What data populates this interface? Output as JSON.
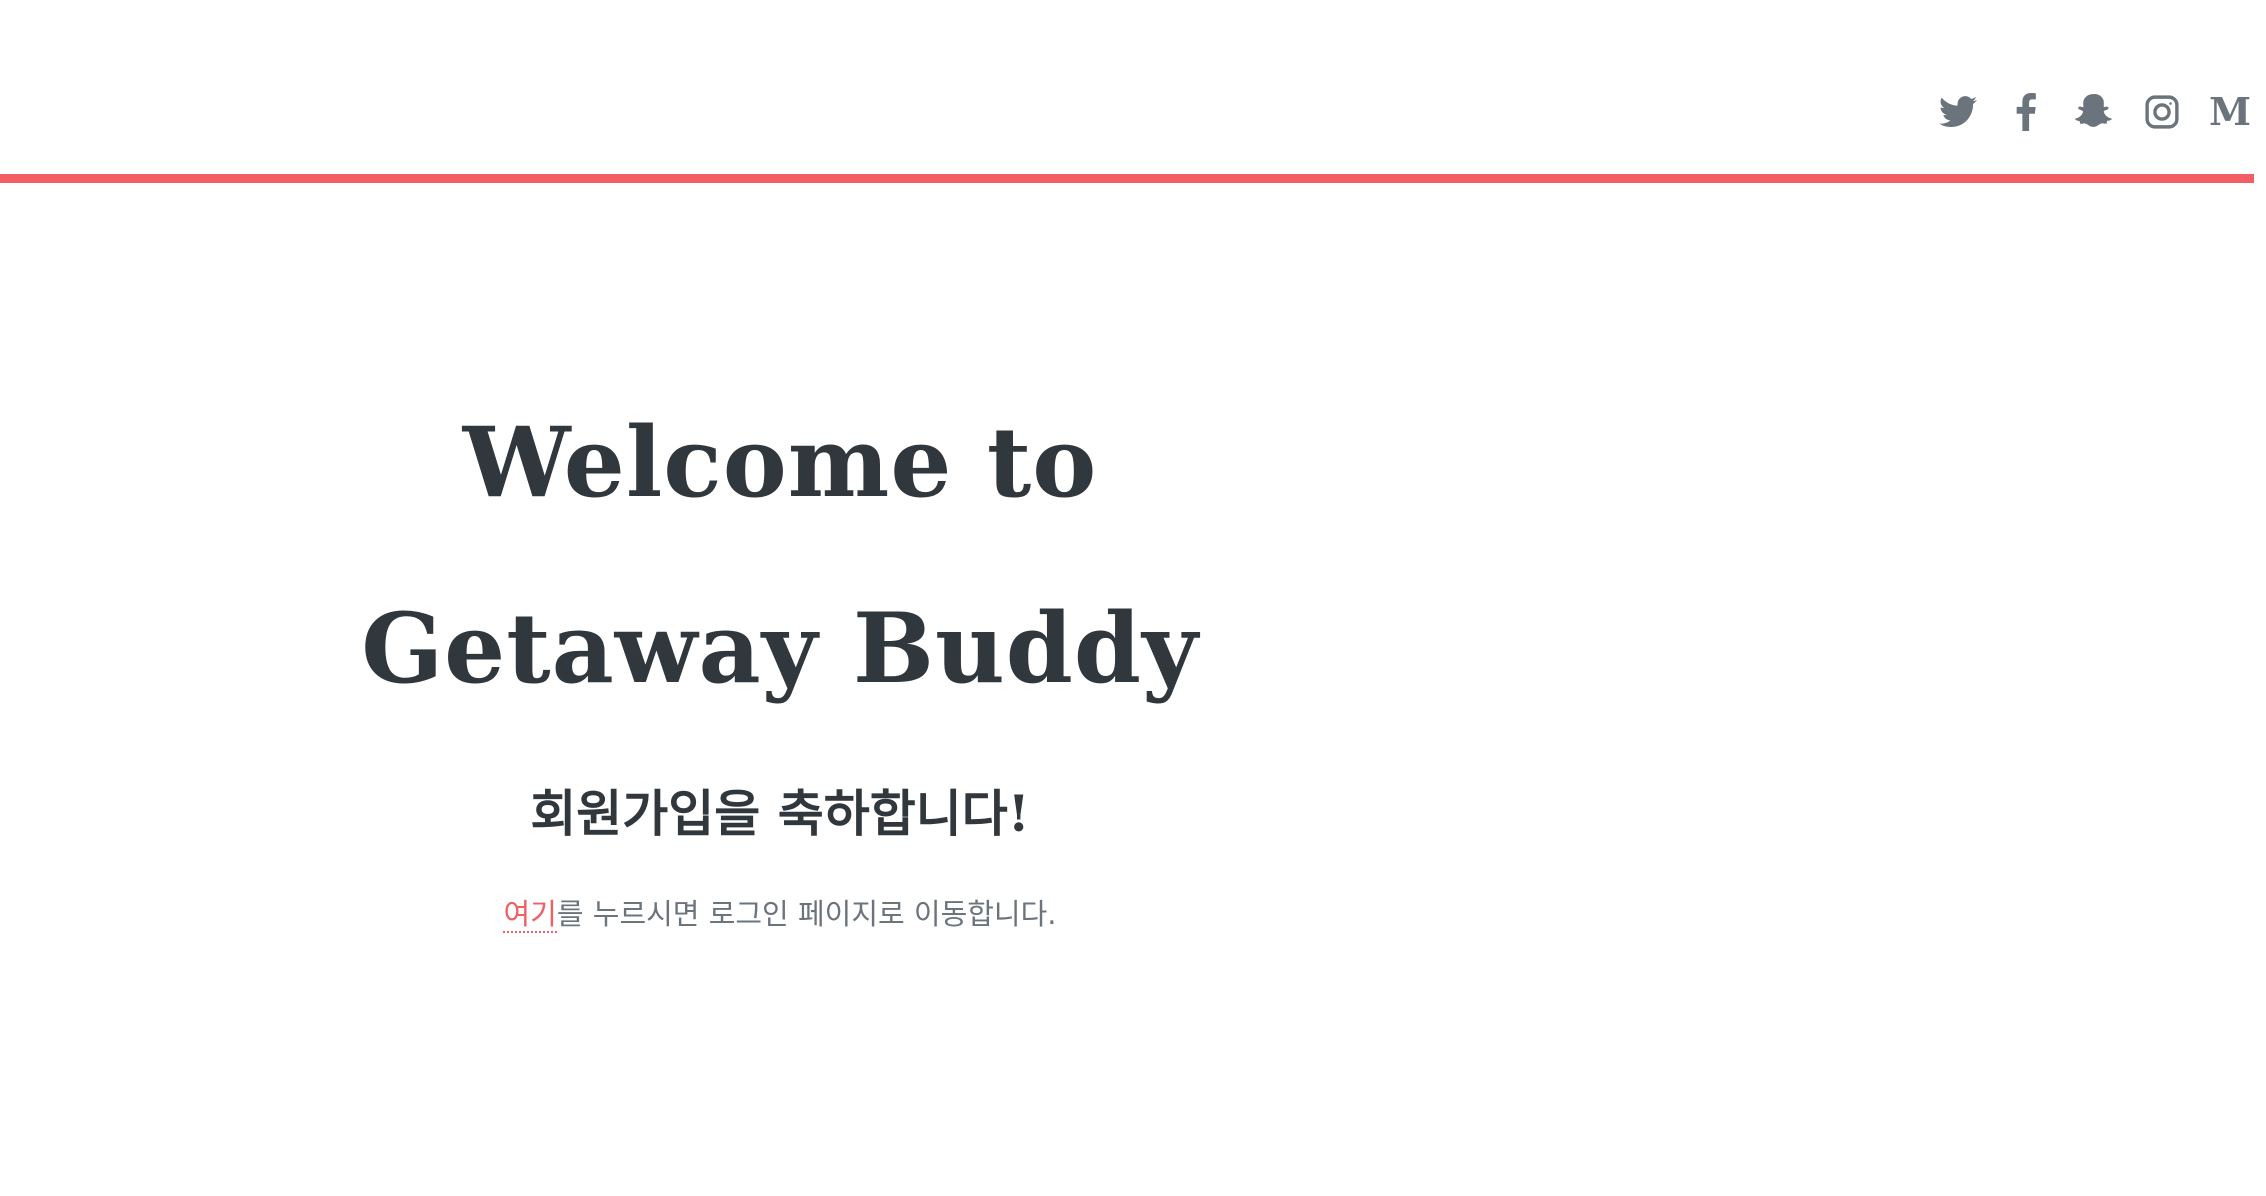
{
  "header": {
    "accent_color": "#f25e64",
    "social_links": [
      {
        "name": "twitter",
        "icon": "twitter-icon"
      },
      {
        "name": "facebook",
        "icon": "facebook-icon"
      },
      {
        "name": "snapchat",
        "icon": "snapchat-icon"
      },
      {
        "name": "instagram",
        "icon": "instagram-icon"
      },
      {
        "name": "medium",
        "icon": "medium-icon",
        "glyph": "M"
      }
    ]
  },
  "main": {
    "title_line1": "Welcome to",
    "title_line2": "Getaway Buddy",
    "subtitle": "회원가입을 축하합니다!",
    "hint_link": "여기",
    "hint_rest": "를 누르시면 로그인 페이지로 이동합니다."
  },
  "colors": {
    "text_dark": "#30373d",
    "text_muted": "#6b747d",
    "accent": "#f25e64"
  }
}
